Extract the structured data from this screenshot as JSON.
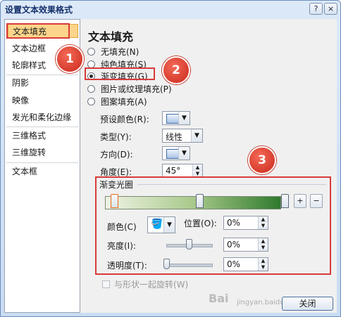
{
  "window": {
    "title": "设置文本效果格式",
    "help_btn": "?",
    "close_btn": "×"
  },
  "sidebar": {
    "items": [
      {
        "label": "文本填充",
        "selected": true
      },
      {
        "label": "文本边框"
      },
      {
        "label": "轮廓样式"
      },
      {
        "label": "阴影"
      },
      {
        "label": "映像"
      },
      {
        "label": "发光和柔化边缘"
      },
      {
        "label": "三维格式"
      },
      {
        "label": "三维旋转"
      },
      {
        "label": "文本框"
      }
    ]
  },
  "panel": {
    "title": "文本填充",
    "fill_options": [
      {
        "label": "无填充(N)",
        "checked": false
      },
      {
        "label": "纯色填充(S)",
        "checked": false
      },
      {
        "label": "渐变填充(G)",
        "checked": true
      },
      {
        "label": "图片或纹理填充(P)",
        "checked": false
      },
      {
        "label": "图案填充(A)",
        "checked": false
      }
    ],
    "preset_colors_label": "预设颜色(R):",
    "type_label": "类型(Y):",
    "type_value": "线性",
    "direction_label": "方向(D):",
    "angle_label": "角度(E):",
    "angle_value": "45°",
    "gradient_stops": {
      "group_label": "渐变光圈",
      "stops": [
        {
          "position": 0,
          "selected": true
        },
        {
          "position": 0.5
        },
        {
          "position": 1.0
        }
      ],
      "add_icon": "add-gradient-stop-icon",
      "remove_icon": "remove-gradient-stop-icon",
      "color_label": "颜色(C)",
      "position_label": "位置(O):",
      "position_value": "0%",
      "brightness_label": "亮度(I):",
      "brightness_value": "0%",
      "brightness_level": 0.5,
      "transparency_label": "透明度(T):",
      "transparency_value": "0%",
      "transparency_level": 0.0
    },
    "rotate_with_shape_label": "与形状一起旋转(W)"
  },
  "footer": {
    "close_label": "关闭"
  },
  "callouts": [
    "1",
    "2",
    "3"
  ],
  "watermark": "jingyan.baidu.com",
  "colors": {
    "accent_red": "#d93a3a",
    "selected_bg": "#fcd58a",
    "gradient_end": "#2f7a2e"
  }
}
